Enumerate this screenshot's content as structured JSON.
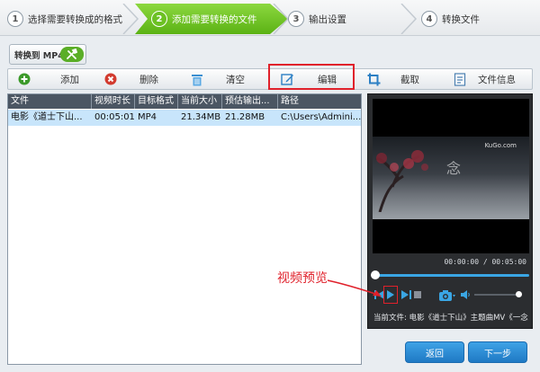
{
  "steps": [
    {
      "num": "1",
      "label": "选择需要转换成的格式"
    },
    {
      "num": "2",
      "label": "添加需要转换的文件"
    },
    {
      "num": "3",
      "label": "输出设置"
    },
    {
      "num": "4",
      "label": "转换文件"
    }
  ],
  "convert_button": {
    "label": "转换到 MP4"
  },
  "toolbar": {
    "add": "添加",
    "delete": "删除",
    "clear": "清空",
    "edit": "编辑",
    "crop": "截取",
    "info": "文件信息"
  },
  "table": {
    "columns": [
      "文件",
      "视频时长",
      "目标格式",
      "当前大小",
      "预估输出...",
      "路径"
    ],
    "rows": [
      [
        "电影《道士下山...",
        "00:05:01",
        "MP4",
        "21.34MB",
        "21.28MB",
        "C:\\Users\\Admini..."
      ]
    ]
  },
  "preview": {
    "watermark": "KuGo.com",
    "time": "00:00:00 / 00:05:00",
    "now_playing": "当前文件: 电影《道士下山》主题曲MV《一念",
    "frame_glyph": "念"
  },
  "annotation": {
    "label": "视频预览"
  },
  "nav": {
    "back": "返回",
    "next": "下一步"
  },
  "colors": {
    "accent_green": "#6cc123",
    "accent_blue": "#2b8ad6",
    "highlight_red": "#e0212b",
    "selection": "#c8e5fb"
  }
}
